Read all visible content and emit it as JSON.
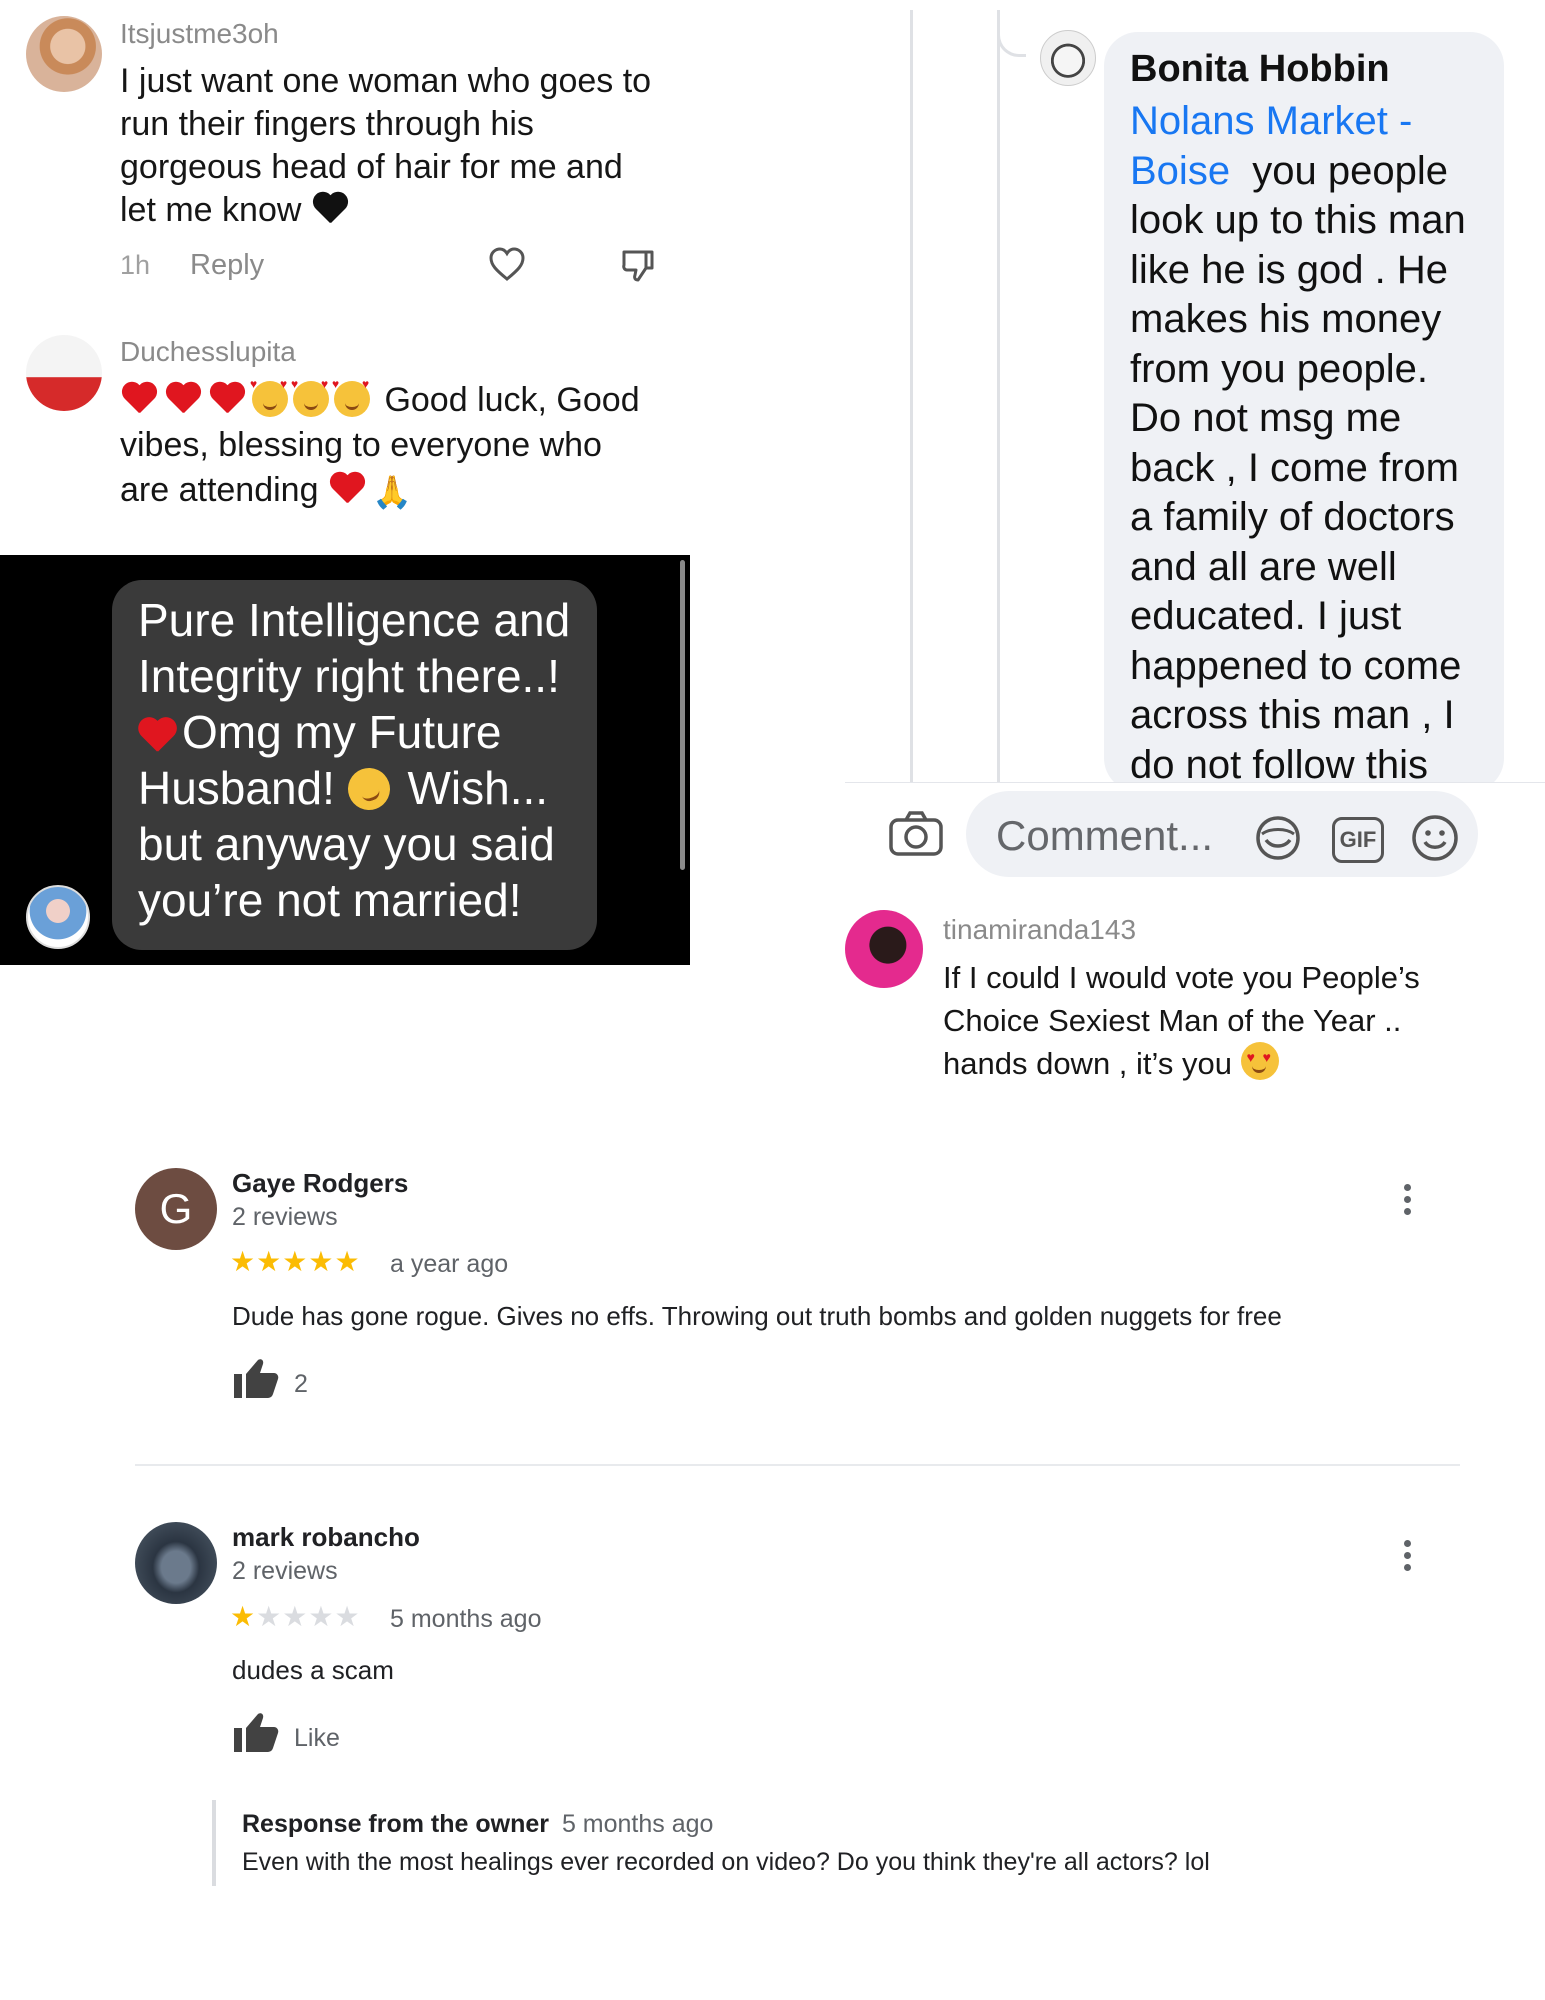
{
  "tiktok_comments": [
    {
      "username": "Itsjustme3oh",
      "text": "I just want one woman who goes to run their fingers through his gorgeous head of hair for me and let me know",
      "lines": [
        "I just want one woman who goes to",
        "run their fingers through his",
        "gorgeous head of hair for me and",
        "let me know"
      ],
      "time": "1h",
      "reply_label": "Reply"
    },
    {
      "username": "Duchesslupita",
      "lines": [
        "Good luck, Good",
        "vibes, blessing to everyone who",
        "are attending"
      ]
    }
  ],
  "dark_comment": {
    "lines": [
      "Pure Intelligence and",
      "Integrity right there..!",
      "Omg my Future",
      "Husband!",
      "Wish...",
      "but anyway you said",
      "you’re not married!"
    ]
  },
  "facebook_comment": {
    "name": "Bonita Hobbin",
    "link_text_1": "Nolans Market -",
    "link_text_2": "Boise",
    "lines": [
      "you people",
      "look up to this man",
      "like he is god . He",
      "makes his money",
      "from you people.",
      "Do not msg me",
      "back , I come from",
      "a family of doctors",
      "and all are well",
      "educated. I just",
      "happened to come",
      "across this man , I",
      "do not follow this"
    ],
    "comment_placeholder": "Comment...",
    "gif_label": "GIF"
  },
  "instagram_comment": {
    "username": "tinamiranda143",
    "lines": [
      "If I could I would vote you People’s",
      "Choice Sexiest Man of the Year ..",
      "hands down , it’s you"
    ]
  },
  "google_reviews": [
    {
      "initial": "G",
      "name": "Gaye Rodgers",
      "reviews": "2 reviews",
      "stars": 5,
      "time": "a year ago",
      "text": "Dude has gone rogue.  Gives no effs.  Throwing out truth bombs and golden nuggets for free",
      "likes": "2"
    },
    {
      "name": "mark robancho",
      "reviews": "2 reviews",
      "stars": 1,
      "time": "5 months ago",
      "text": "dudes a scam",
      "like_label": "Like",
      "owner_response_label": "Response from the owner",
      "owner_response_time": "5 months ago",
      "owner_response_text": "Even with the most healings ever recorded on video? Do you think they're all actors? lol"
    }
  ],
  "colors": {
    "link_blue": "#1877f2",
    "star_gold": "#fbbc04",
    "star_empty": "#dadce0",
    "avatar_brown": "#6d4c41"
  }
}
